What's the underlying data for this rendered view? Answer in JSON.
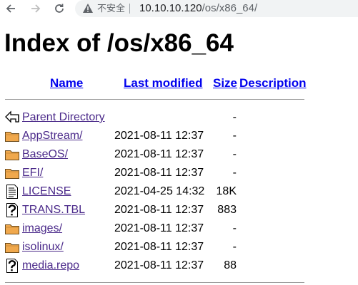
{
  "browser": {
    "security_label": "不安全",
    "url_host": "10.10.10.120",
    "url_path": "/os/x86_64/"
  },
  "page": {
    "title": "Index of /os/x86_64",
    "columns": {
      "name": "Name",
      "last_modified": "Last modified",
      "size": "Size",
      "description": "Description"
    },
    "entries": [
      {
        "icon": "back-icon",
        "name": "Parent Directory",
        "modified": "",
        "size": "-"
      },
      {
        "icon": "folder-icon",
        "name": "AppStream/",
        "modified": "2021-08-11 12:37",
        "size": "-"
      },
      {
        "icon": "folder-icon",
        "name": "BaseOS/",
        "modified": "2021-08-11 12:37",
        "size": "-"
      },
      {
        "icon": "folder-icon",
        "name": "EFI/",
        "modified": "2021-08-11 12:37",
        "size": "-"
      },
      {
        "icon": "text-file-icon",
        "name": "LICENSE",
        "modified": "2021-04-25 14:32",
        "size": "18K"
      },
      {
        "icon": "unknown-file-icon",
        "name": "TRANS.TBL",
        "modified": "2021-08-11 12:37",
        "size": "883"
      },
      {
        "icon": "folder-icon",
        "name": "images/",
        "modified": "2021-08-11 12:37",
        "size": "-"
      },
      {
        "icon": "folder-icon",
        "name": "isolinux/",
        "modified": "2021-08-11 12:37",
        "size": "-"
      },
      {
        "icon": "unknown-file-icon",
        "name": "media.repo",
        "modified": "2021-08-11 12:37",
        "size": "88"
      }
    ]
  },
  "colors": {
    "link": "#0000ee",
    "visited_link": "#4b2a8a",
    "folder_fill": "#f0a84c",
    "address_bar_bg": "#f1f3f4"
  }
}
